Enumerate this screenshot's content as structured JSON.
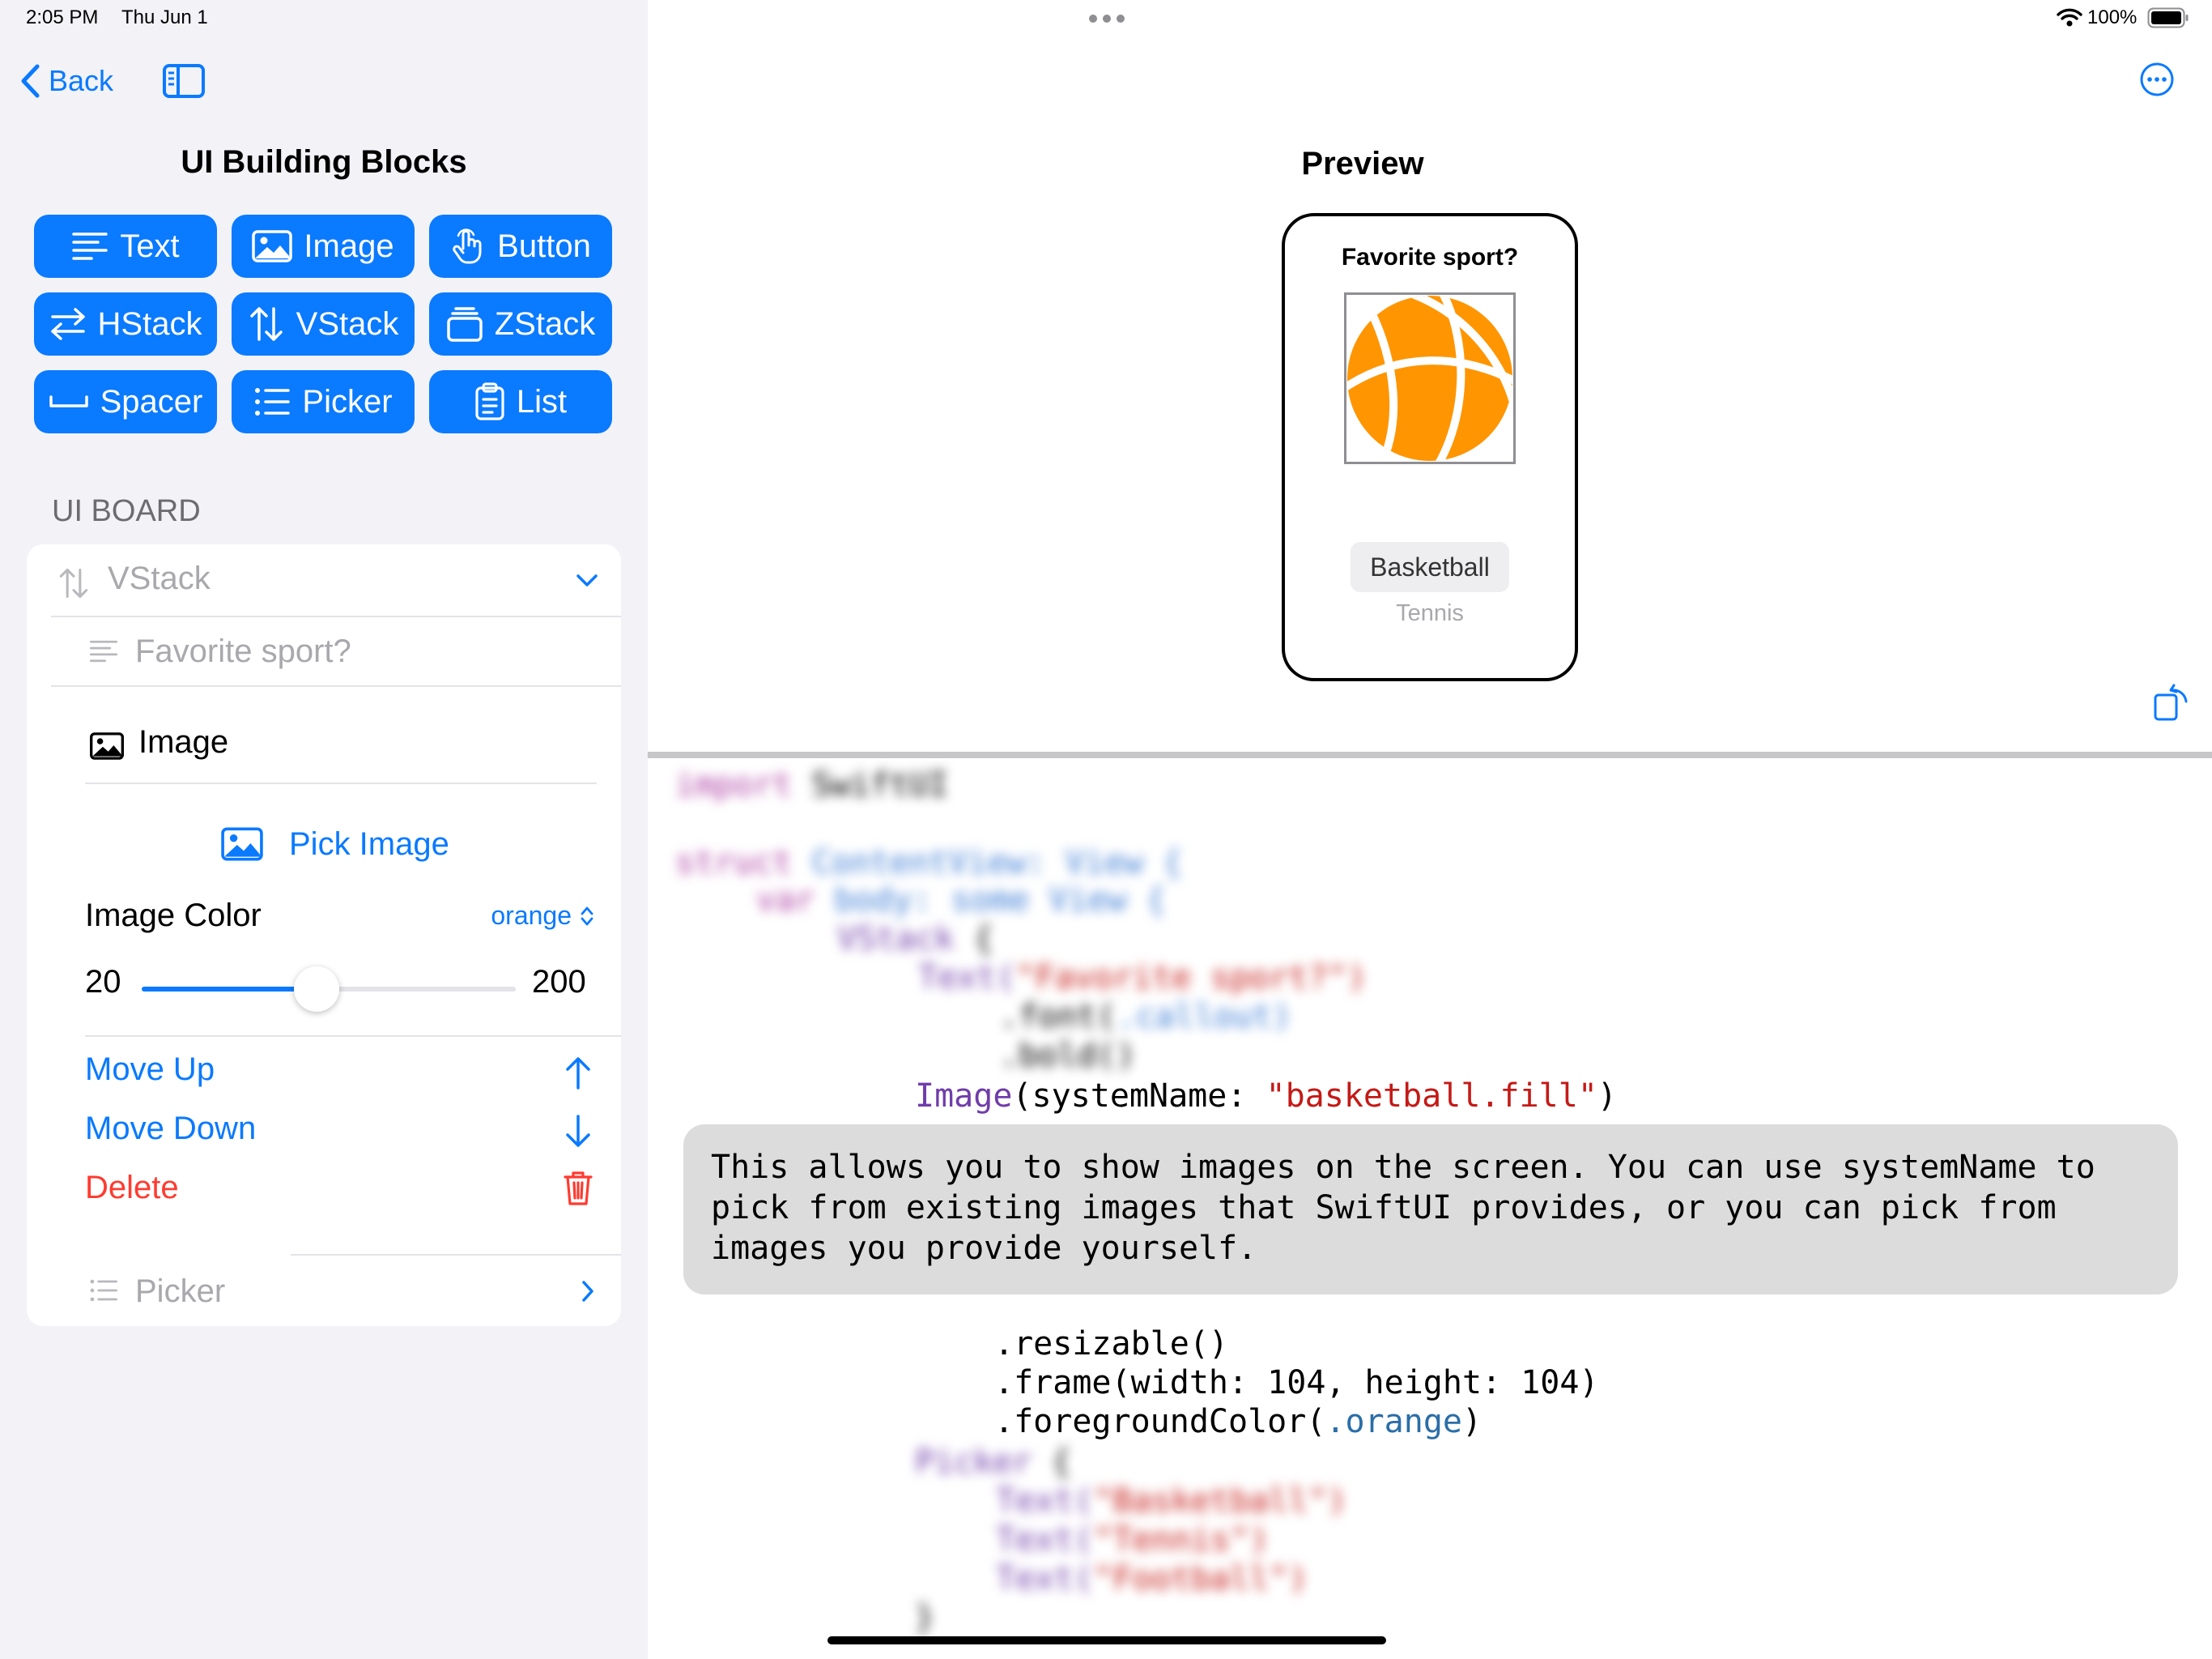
{
  "status_bar": {
    "time": "2:05 PM",
    "date": "Thu Jun 1",
    "battery": "100%"
  },
  "sidebar": {
    "back_label": "Back",
    "title": "UI Building Blocks",
    "blocks": [
      {
        "label": "Text",
        "icon": "text-lines-icon"
      },
      {
        "label": "Image",
        "icon": "photo-icon"
      },
      {
        "label": "Button",
        "icon": "hand-point-icon"
      },
      {
        "label": "HStack",
        "icon": "horizontal-arrows-icon"
      },
      {
        "label": "VStack",
        "icon": "vertical-arrows-icon"
      },
      {
        "label": "ZStack",
        "icon": "stack-layers-icon"
      },
      {
        "label": "Spacer",
        "icon": "spacer-icon"
      },
      {
        "label": "Picker",
        "icon": "list-bullet-icon"
      },
      {
        "label": "List",
        "icon": "clipboard-list-icon"
      }
    ],
    "section_header": "UI BOARD",
    "board": {
      "vstack_label": "VStack",
      "text_item_label": "Favorite sport?",
      "image_item_label": "Image",
      "pick_image_label": "Pick Image",
      "image_color_label": "Image Color",
      "image_color_value": "orange",
      "slider_min": "20",
      "slider_max": "200",
      "slider_value": 104,
      "move_up_label": "Move Up",
      "move_down_label": "Move Down",
      "delete_label": "Delete",
      "picker_item_label": "Picker"
    }
  },
  "preview": {
    "title": "Preview",
    "question": "Favorite sport?",
    "picker_selected": "Basketball",
    "picker_next": "Tennis"
  },
  "code": {
    "blurred_top": [
      [
        "import",
        " SwiftUI"
      ],
      [
        "struct",
        " ContentView: View {"
      ],
      [
        "var",
        " body: some View {"
      ],
      [
        "VStack",
        " {"
      ],
      [
        "Text(",
        "\"Favorite sport?\")"
      ],
      [
        ".font(",
        ".callout)"
      ],
      [
        ".bold()",
        ""
      ]
    ],
    "image_line_type": "Image",
    "image_line_mid": "(systemName: ",
    "image_line_string": "\"basketball.fill\"",
    "image_line_end": ")",
    "explanation": "This allows you to show images on the screen. You can use systemName to pick from existing images that SwiftUI provides, or you can pick from images you provide yourself.",
    "modifier_resizable": ".resizable()",
    "modifier_frame": ".frame(width: 104, height: 104)",
    "modifier_fg_prefix": ".foregroundColor(",
    "modifier_fg_value": ".orange",
    "modifier_fg_suffix": ")",
    "blurred_bottom": [
      [
        "Picker",
        " {"
      ],
      [
        "Text(",
        "\"Basketball\")"
      ],
      [
        "Text(",
        "\"Tennis\")"
      ],
      [
        "Text(",
        "\"Football\")"
      ],
      [
        "}",
        ""
      ]
    ]
  },
  "colors": {
    "accent": "#0a7aff",
    "destructive": "#ff3b30",
    "orange": "#ff9500",
    "keyword": "#ad3da4",
    "string": "#c41a16",
    "type": "#703daa"
  }
}
